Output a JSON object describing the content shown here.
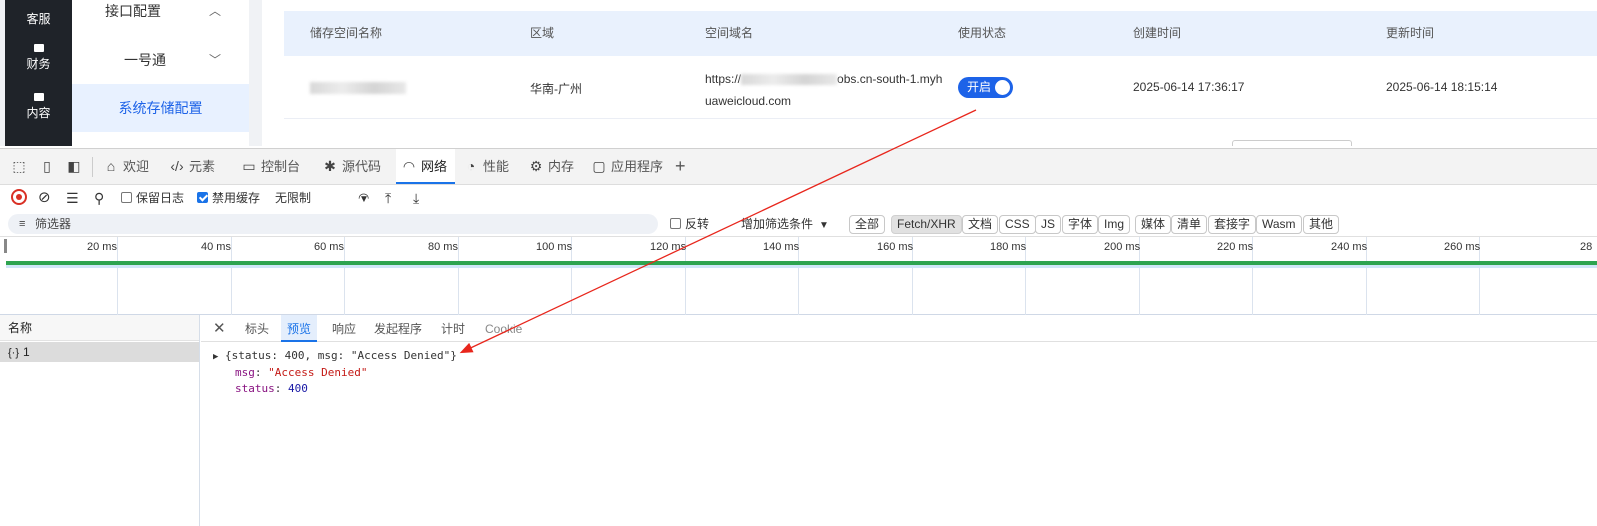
{
  "page": {
    "left_nav": [
      {
        "label": "客服",
        "icon": "headset-icon"
      },
      {
        "label": "财务",
        "icon": "wallet-icon"
      },
      {
        "label": "内容",
        "icon": "book-icon"
      }
    ],
    "sub_nav": {
      "interface_config": "接口配置",
      "yihaotong": "一号通",
      "storage_config": "系统存储配置"
    },
    "table": {
      "headers": [
        "储存空间名称",
        "区域",
        "空间域名",
        "使用状态",
        "创建时间",
        "更新时间"
      ],
      "row": {
        "region": "华南-广州",
        "domain_prefix": "https://",
        "domain_suffix": "obs.cn-south-1.myh",
        "domain_line2": "uaweicloud.com",
        "status": "开启",
        "created": "2025-06-14 17:36:17",
        "updated": "2025-06-14 18:15:14"
      }
    }
  },
  "devtools": {
    "tabs": [
      {
        "label": "欢迎",
        "icon": "home-icon"
      },
      {
        "label": "元素",
        "icon": "code-icon"
      },
      {
        "label": "控制台",
        "icon": "console-icon"
      },
      {
        "label": "源代码",
        "icon": "bug-icon"
      },
      {
        "label": "网络",
        "icon": "wifi-icon"
      },
      {
        "label": "性能",
        "icon": "gauge-icon"
      },
      {
        "label": "内存",
        "icon": "memory-icon"
      },
      {
        "label": "应用程序",
        "icon": "app-icon"
      }
    ],
    "add_tab": "+",
    "network_toolbar": {
      "preserve_log": "保留日志",
      "preserve_log_checked": false,
      "disable_cache": "禁用缓存",
      "disable_cache_checked": true,
      "throttling": "无限制"
    },
    "filter": {
      "placeholder": "筛选器",
      "invert": "反转",
      "more_filters": "增加筛选条件",
      "types": [
        "全部",
        "Fetch/XHR",
        "文档",
        "CSS",
        "JS",
        "字体",
        "Img",
        "媒体",
        "清单",
        "套接字",
        "Wasm",
        "其他"
      ],
      "active_type": "Fetch/XHR"
    },
    "timeline_ticks": [
      "20 ms",
      "40 ms",
      "60 ms",
      "80 ms",
      "100 ms",
      "120 ms",
      "140 ms",
      "160 ms",
      "180 ms",
      "200 ms",
      "220 ms",
      "240 ms",
      "260 ms",
      "28"
    ],
    "names_header": "名称",
    "request_name": "1",
    "detail_tabs": [
      "标头",
      "预览",
      "响应",
      "发起程序",
      "计时",
      "Cookie"
    ],
    "active_detail_tab": "预览",
    "preview": {
      "summary": "{status: 400, msg: \"Access Denied\"}",
      "msg_key": "msg",
      "msg_value": "\"Access Denied\"",
      "status_key": "status",
      "status_value": "400"
    }
  },
  "colors": {
    "accent": "#1d63e8",
    "annotation_arrow": "#e8261c",
    "waterfall": "#2ea44f"
  }
}
